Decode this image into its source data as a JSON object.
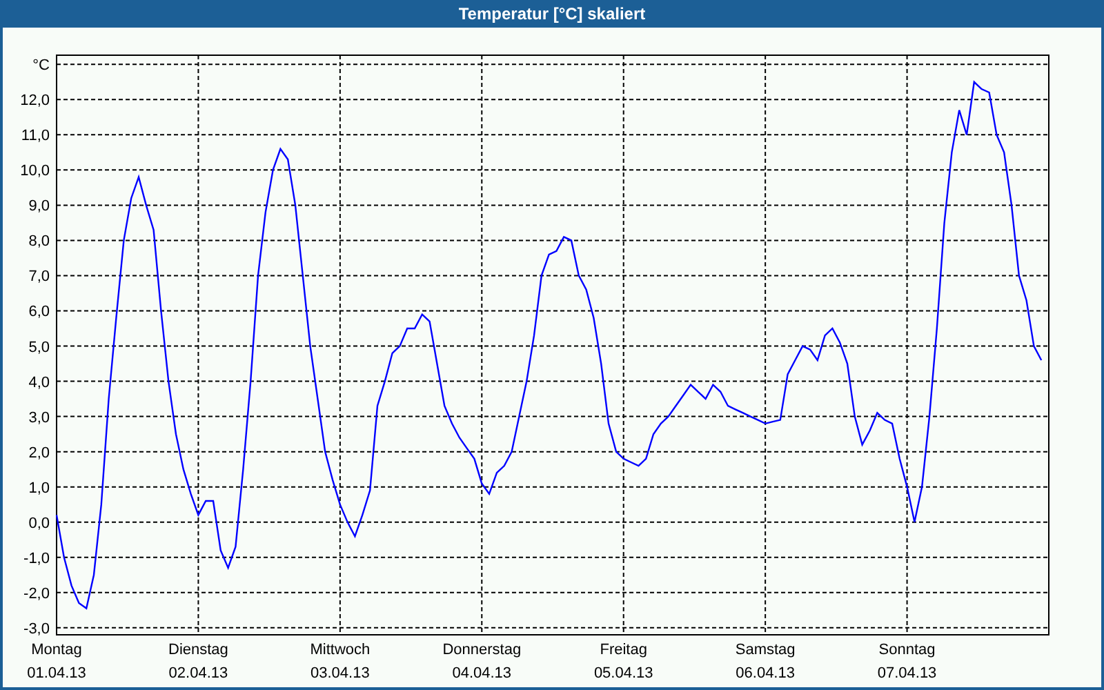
{
  "window": {
    "title": "Temperatur [°C] skaliert"
  },
  "chart": {
    "chart_data": {
      "type": "line",
      "grid": true,
      "ylabel": "°C",
      "ylim": [
        -3.2,
        13.26
      ],
      "yticks": [
        {
          "value": -3,
          "label": "-3,0"
        },
        {
          "value": -2,
          "label": "-2,0"
        },
        {
          "value": -1,
          "label": "-1,0"
        },
        {
          "value": 0,
          "label": "0,0"
        },
        {
          "value": 1,
          "label": "1,0"
        },
        {
          "value": 2,
          "label": "2,0"
        },
        {
          "value": 3,
          "label": "3,0"
        },
        {
          "value": 4,
          "label": "4,0"
        },
        {
          "value": 5,
          "label": "5,0"
        },
        {
          "value": 6,
          "label": "6,0"
        },
        {
          "value": 7,
          "label": "7,0"
        },
        {
          "value": 8,
          "label": "8,0"
        },
        {
          "value": 9,
          "label": "9,0"
        },
        {
          "value": 10,
          "label": "10,0"
        },
        {
          "value": 11,
          "label": "11,0"
        },
        {
          "value": 12,
          "label": "12,0"
        }
      ],
      "categories": [
        "Montag 01.04.13",
        null,
        null,
        null,
        null,
        null,
        null,
        null,
        null,
        null,
        null,
        null,
        null,
        null,
        null,
        null,
        null,
        null,
        null,
        "Dienstag 02.04.13",
        null,
        null,
        null,
        null,
        null,
        null,
        null,
        null,
        null,
        null,
        null,
        null,
        null,
        null,
        null,
        null,
        null,
        null,
        "Mittwoch 03.04.13",
        null,
        null,
        null,
        null,
        null,
        null,
        null,
        null,
        null,
        null,
        null,
        null,
        null,
        null,
        null,
        null,
        null,
        null,
        "Donnerstag 04.04.13",
        null,
        null,
        null,
        null,
        null,
        null,
        null,
        null,
        null,
        null,
        null,
        null,
        null,
        null,
        null,
        null,
        null,
        null,
        "Freitag 05.04.13",
        null,
        null,
        null,
        null,
        null,
        null,
        null,
        null,
        null,
        null,
        null,
        null,
        null,
        null,
        null,
        null,
        null,
        null,
        "Samstag 06.04.13",
        null,
        null,
        null,
        null,
        null,
        null,
        null,
        null,
        null,
        null,
        null,
        null,
        null,
        null,
        null,
        null,
        null,
        null,
        "Sonntag 07.04.13",
        null,
        null,
        null,
        null,
        null,
        null,
        null,
        null,
        null,
        null,
        null,
        null,
        null,
        null,
        null,
        null,
        null,
        null
      ],
      "series": [
        {
          "color": "#0000ff",
          "values": [
            0.2,
            -1.0,
            -1.8,
            -2.3,
            -2.45,
            -1.5,
            0.5,
            3.5,
            5.8,
            8.0,
            9.2,
            9.8,
            9.0,
            8.3,
            6.0,
            4.0,
            2.5,
            1.5,
            0.8,
            0.2,
            0.6,
            0.6,
            -0.8,
            -1.3,
            -0.7,
            1.5,
            4.0,
            7.0,
            8.8,
            10.0,
            10.6,
            10.3,
            9.0,
            7.0,
            5.0,
            3.5,
            2.0,
            1.2,
            0.5,
            0.0,
            -0.4,
            0.2,
            0.9,
            3.3,
            4.0,
            4.8,
            5.0,
            5.5,
            5.5,
            5.9,
            5.7,
            4.5,
            3.3,
            2.8,
            2.4,
            2.1,
            1.8,
            1.1,
            0.8,
            1.4,
            1.6,
            2.0,
            3.0,
            4.0,
            5.3,
            7.0,
            7.6,
            7.7,
            8.1,
            8.0,
            7.0,
            6.6,
            5.8,
            4.5,
            2.8,
            2.0,
            1.8,
            1.7,
            1.6,
            1.8,
            2.5,
            2.8,
            3.0,
            3.3,
            3.6,
            3.9,
            3.7,
            3.5,
            3.9,
            3.7,
            3.3,
            3.2,
            3.1,
            3.0,
            2.9,
            2.8,
            2.85,
            2.9,
            4.2,
            4.6,
            5.0,
            4.9,
            4.6,
            5.3,
            5.5,
            5.1,
            4.5,
            3.0,
            2.2,
            2.6,
            3.1,
            2.9,
            2.8,
            1.8,
            1.0,
            0.0,
            1.0,
            3.0,
            5.5,
            8.5,
            10.5,
            11.7,
            11.0,
            12.5,
            12.3,
            12.2,
            11.0,
            10.5,
            9.0,
            7.0,
            6.3,
            5.0,
            4.6
          ]
        }
      ]
    }
  }
}
